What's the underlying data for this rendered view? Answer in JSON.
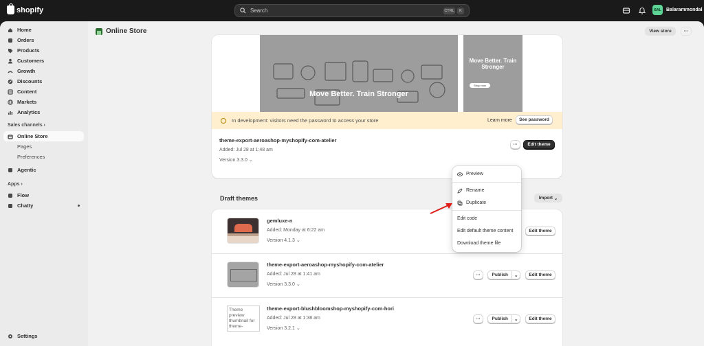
{
  "topbar": {
    "brand": "shopify",
    "search_placeholder": "Search",
    "kbd_ctrl": "CTRL",
    "kbd_k": "K",
    "user_initials": "BAL",
    "user_name": "Balarammondal"
  },
  "sidebar": {
    "items": [
      {
        "label": "Home",
        "icon": "home-icon"
      },
      {
        "label": "Orders",
        "icon": "orders-icon"
      },
      {
        "label": "Products",
        "icon": "tag-icon"
      },
      {
        "label": "Customers",
        "icon": "person-icon"
      },
      {
        "label": "Growth",
        "icon": "growth-icon"
      },
      {
        "label": "Discounts",
        "icon": "discount-icon"
      },
      {
        "label": "Content",
        "icon": "content-icon"
      },
      {
        "label": "Markets",
        "icon": "globe-icon"
      },
      {
        "label": "Analytics",
        "icon": "analytics-icon"
      }
    ],
    "sales_channels_label": "Sales channels",
    "online_store": "Online Store",
    "sub_items": [
      "Pages",
      "Preferences"
    ],
    "agentic": "Agentic",
    "apps_label": "Apps",
    "apps": [
      "Flow",
      "Chatty"
    ],
    "settings": "Settings"
  },
  "header": {
    "title": "Online Store",
    "view_store": "View store",
    "more": "···"
  },
  "current_theme": {
    "preview_headline": "Move Better. Train Stronger",
    "preview_small_headline": "Move Better. Train Stronger",
    "preview_small_button": "Shop now",
    "banner_text": "In development: visitors need the password to access your store",
    "learn_more": "Learn more",
    "see_password": "See password",
    "name": "theme-export-aeroashop-myshopify-com-atelier",
    "added": "Added: Jul 28 at 1:48 am",
    "version": "Version 3.3.0",
    "more": "···",
    "edit_theme": "Edit theme"
  },
  "menu": {
    "items": [
      "Preview",
      "Rename",
      "Duplicate",
      "Edit code",
      "Edit default theme content",
      "Download theme file"
    ]
  },
  "drafts": {
    "title": "Draft themes",
    "import": "Import",
    "themes": [
      {
        "name": "gemluxe-n",
        "added": "Added: Monday at 6:22 am",
        "version": "Version 4.1.3",
        "edit": "Edit theme"
      },
      {
        "name": "theme-export-aeroashop-myshopify-com-atelier",
        "added": "Added: Jul 28 at 1:41 am",
        "version": "Version 3.3.0",
        "publish": "Publish",
        "edit": "Edit theme"
      },
      {
        "name": "theme-export-blushbloomshop-myshopify-com-hori",
        "added": "Added: Jul 28 at 1:38 am",
        "version": "Version 3.2.1",
        "publish": "Publish",
        "edit": "Edit theme",
        "thumb_alt": "Theme preview thumbnail for theme-"
      }
    ]
  },
  "colors": {
    "accent": "#303030",
    "banner": "#ffefcf",
    "arrow": "#e0201b"
  }
}
